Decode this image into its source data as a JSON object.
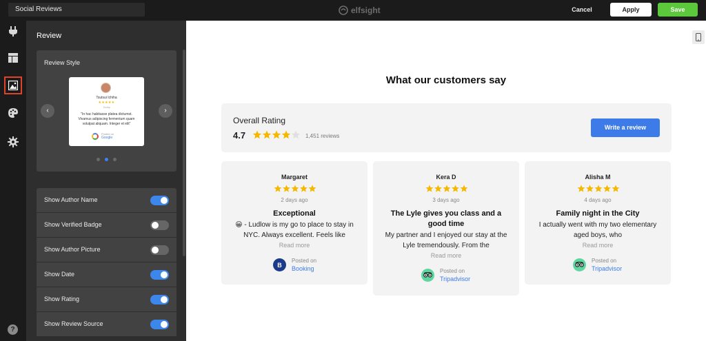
{
  "topbar": {
    "widget_name": "Social Reviews",
    "logo_text": "elfsight",
    "cancel_label": "Cancel",
    "apply_label": "Apply",
    "save_label": "Save"
  },
  "rail": {
    "icons": [
      "plug-icon",
      "layout-icon",
      "image-icon",
      "palette-icon",
      "gear-icon"
    ],
    "active": "image-icon",
    "help_label": "?"
  },
  "panel": {
    "title": "Review",
    "review_style": {
      "title": "Review Style",
      "preview": {
        "author": "Tsutsui Ichiha",
        "stars": "★★★★★",
        "date": "Today",
        "text": "\"In hac habitasse platea dictumst. Vivamus adipiscing fermentum quam volutpat aliquam. Integer et elit\"",
        "source_label": "Posted on",
        "source_name": "Google"
      },
      "prev_label": "‹",
      "next_label": "›",
      "slide_count": 3,
      "active_slide": 1
    },
    "toggles": [
      {
        "label": "Show Author Name",
        "on": true
      },
      {
        "label": "Show Verified Badge",
        "on": false
      },
      {
        "label": "Show Author Picture",
        "on": false
      },
      {
        "label": "Show Date",
        "on": true
      },
      {
        "label": "Show Rating",
        "on": true
      },
      {
        "label": "Show Review Source",
        "on": true
      }
    ]
  },
  "preview": {
    "heading": "What our customers say",
    "overall": {
      "title": "Overall Rating",
      "score": "4.7",
      "count": "1,451 reviews",
      "write_label": "Write a review"
    },
    "reviews": [
      {
        "author": "Margaret",
        "date": "2 days ago",
        "title": "Exceptional",
        "body": "😀 - Ludlow is my go to place to stay in NYC. Always excellent. Feels like",
        "more": "Read more",
        "source_label": "Posted on",
        "source_name": "Booking",
        "source_letter": "B"
      },
      {
        "author": "Kera D",
        "date": "3 days ago",
        "title": "The Lyle gives you class and a good time",
        "body": "My partner and I enjoyed our stay at the Lyle tremendously. From the",
        "more": "Read more",
        "source_label": "Posted on",
        "source_name": "Tripadvisor"
      },
      {
        "author": "Alisha M",
        "date": "4 days ago",
        "title": "Family night in the City",
        "body": "I actually went with my two elementary aged boys, who",
        "more": "Read more",
        "source_label": "Posted on",
        "source_name": "Tripadvisor"
      }
    ]
  },
  "colors": {
    "accent": "#3d7be8",
    "save": "#5cc83b",
    "star": "#f5b800",
    "active_outline": "#e0422b"
  }
}
